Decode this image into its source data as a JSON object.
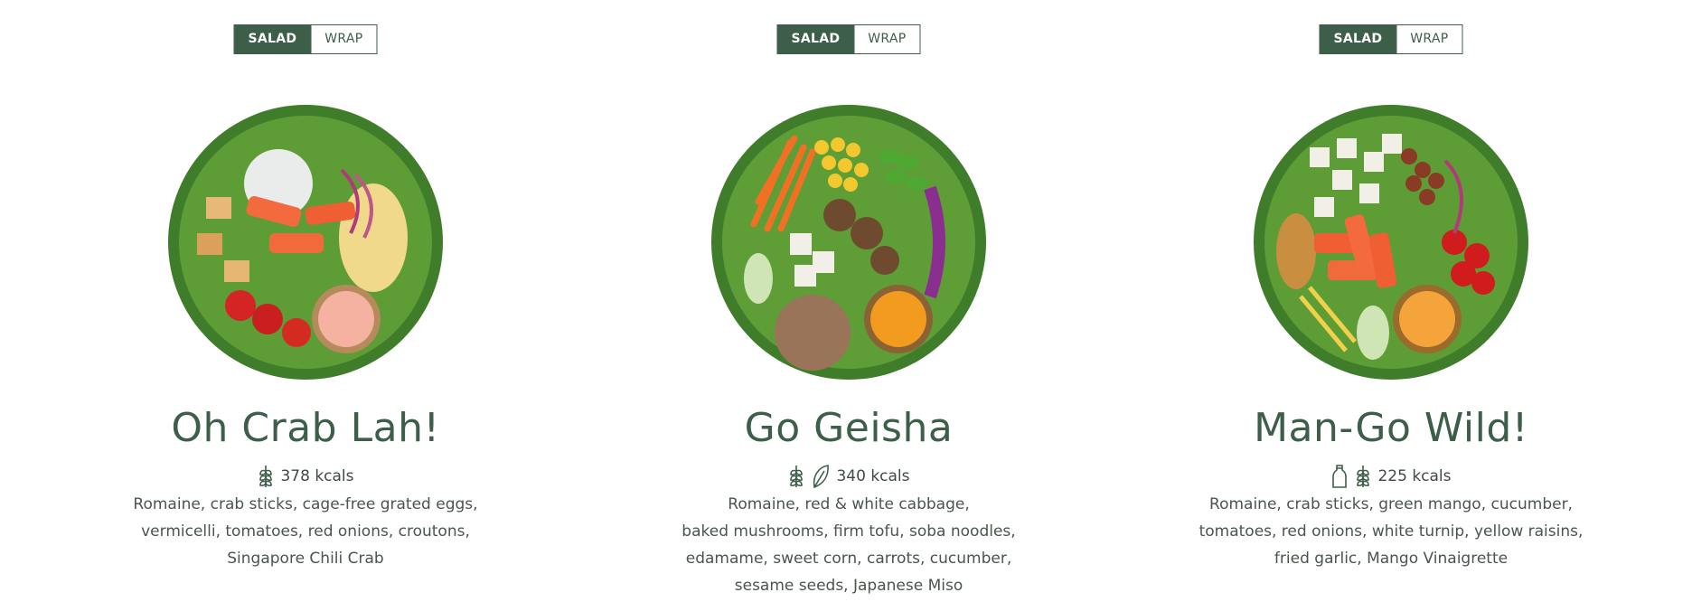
{
  "products": [
    {
      "toggle": {
        "salad": "SALAD",
        "wrap": "WRAP",
        "selected": "SALAD"
      },
      "name": "Oh Crab Lah!",
      "kcals": "378 kcals",
      "icons": [
        "grain-icon"
      ],
      "desc1": "Romaine, crab sticks, cage-free grated eggs,",
      "desc2": "vermicelli, tomatoes, red onions, croutons,",
      "desc3": "Singapore Chili Crab",
      "desc4": ""
    },
    {
      "toggle": {
        "salad": "SALAD",
        "wrap": "WRAP",
        "selected": "SALAD"
      },
      "name": "Go Geisha",
      "kcals": "340 kcals",
      "icons": [
        "grain-icon",
        "leaf-icon"
      ],
      "desc1": "Romaine, red & white cabbage,",
      "desc2": "baked mushrooms, firm tofu, soba noodles,",
      "desc3": "edamame, sweet corn, carrots, cucumber,",
      "desc4": "sesame seeds, Japanese Miso"
    },
    {
      "toggle": {
        "salad": "SALAD",
        "wrap": "WRAP",
        "selected": "SALAD"
      },
      "name": "Man-Go Wild!",
      "kcals": "225 kcals",
      "icons": [
        "milk-bottle-icon",
        "grain-icon"
      ],
      "desc1": "Romaine, crab sticks, green mango, cucumber,",
      "desc2": "tomatoes, red onions, white turnip, yellow raisins,",
      "desc3": "fried garlic, Mango Vinaigrette",
      "desc4": ""
    }
  ],
  "colors": {
    "brand_green": "#3d5e49",
    "text": "#4a554d"
  }
}
